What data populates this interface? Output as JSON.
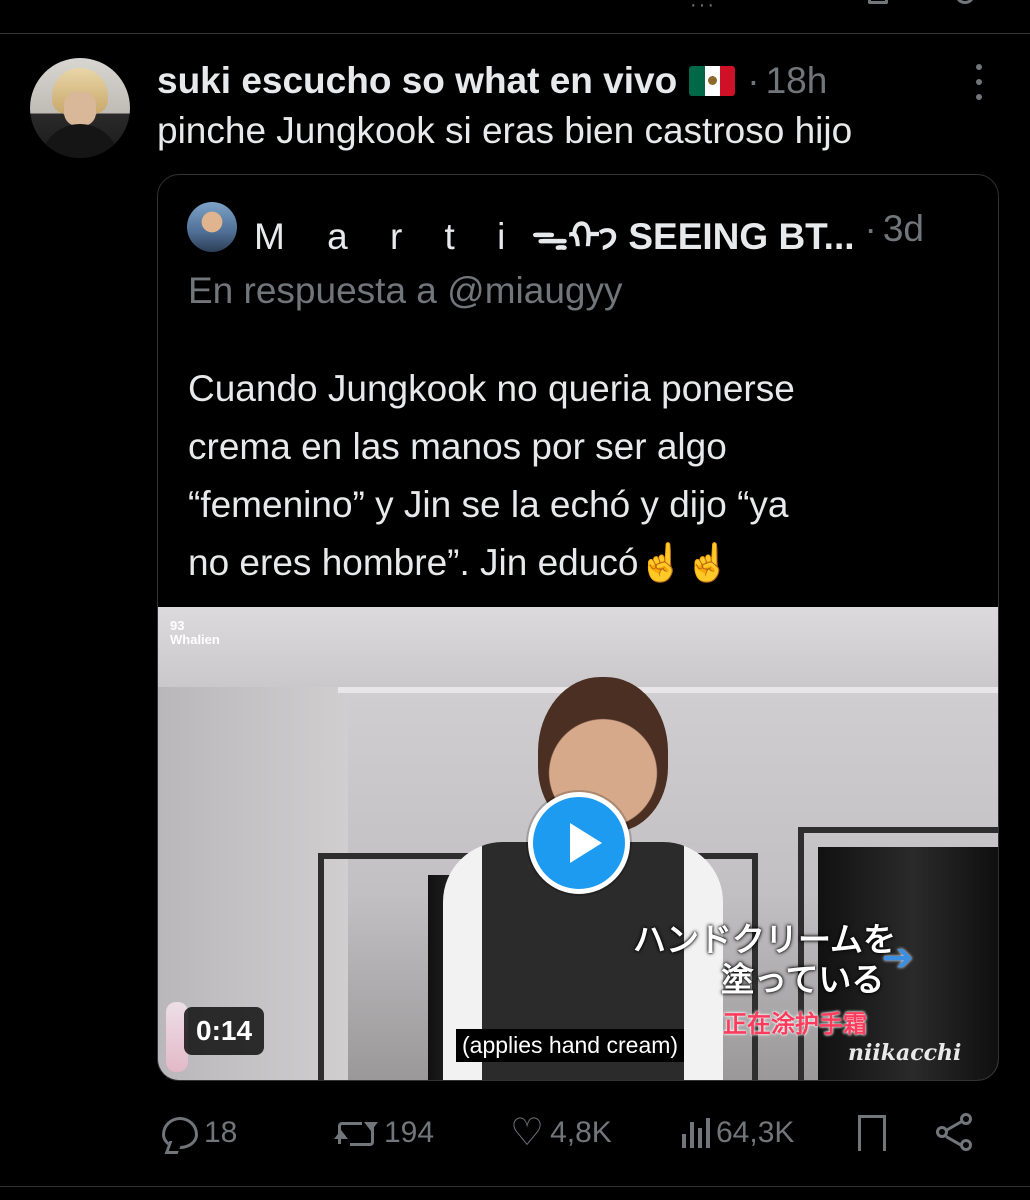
{
  "tweet": {
    "author_name": "suki escucho so what en vivo",
    "separator": "·",
    "time": "18h",
    "text": "pinche Jungkook si eras bien castroso hijo"
  },
  "quoted": {
    "author_name_spaced": "M a r t i",
    "author_name_rest": "ᯓᡣ𐭩 SEEING BT...",
    "separator": "·",
    "time": "3d",
    "reply_to": "En respuesta a @miaugyy",
    "text_lines": [
      "Cuando Jungkook no queria ponerse",
      "crema en las manos por ser algo",
      "“femenino” y Jin se la echó y dijo “ya",
      "no eres hombre”. Jin educó☝️☝️"
    ],
    "video": {
      "duration": "0:14",
      "caption": "(applies hand cream)",
      "overlay_jp_line1": "ハンドクリームを",
      "overlay_jp_line2": "塗っている",
      "overlay_cn": "正在涂护手霜",
      "watermark": "niikacchi",
      "channel_logo": "93\nWhalien",
      "arrow": "➔"
    }
  },
  "actions": {
    "replies": "18",
    "reposts": "194",
    "likes": "4,8K",
    "views": "64,3K"
  },
  "icons": [
    "reply-icon",
    "repost-icon",
    "heart-icon",
    "views-icon",
    "bookmark-icon",
    "share-icon",
    "more-icon",
    "play-icon",
    "mexico-flag-icon"
  ],
  "colors": {
    "background": "#000000",
    "text": "#e7e9ea",
    "muted": "#71767b",
    "border": "#2f3336",
    "accent": "#1d9bf0"
  }
}
